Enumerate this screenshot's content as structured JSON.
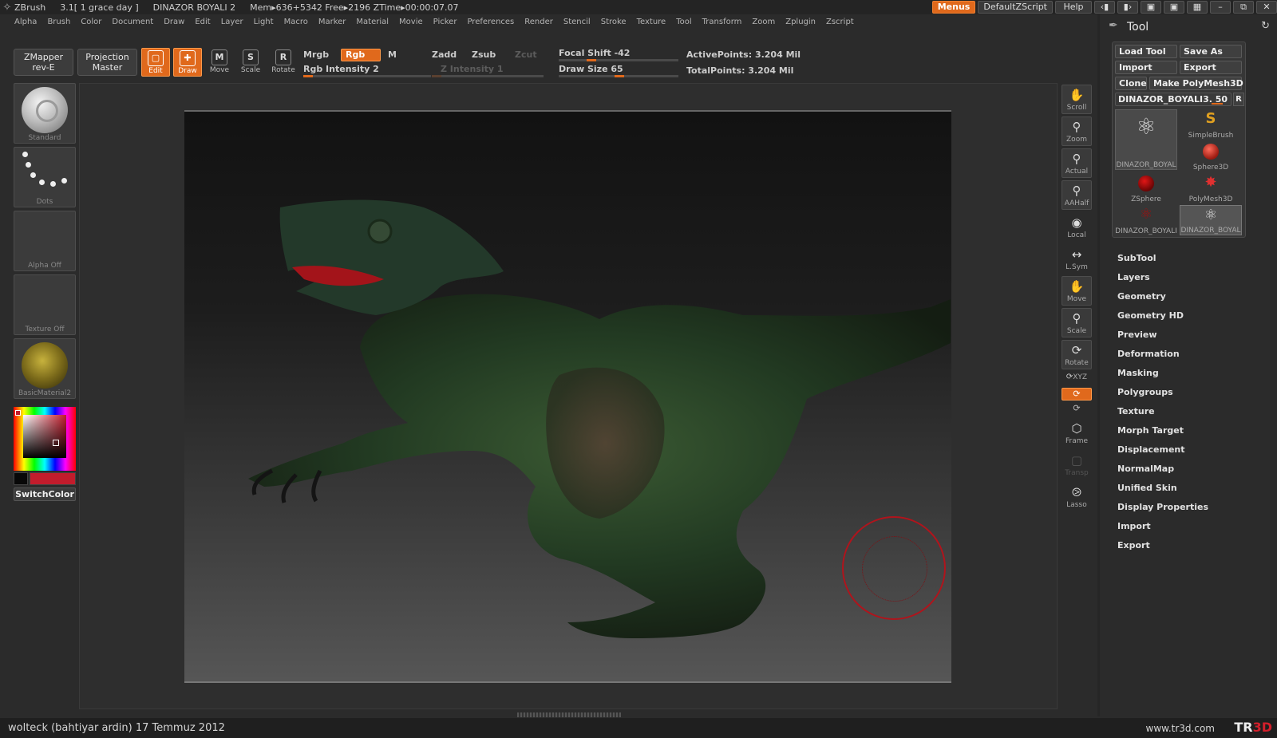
{
  "titlebar": {
    "app": "ZBrush",
    "version": "3.1[ 1 grace day ]",
    "doc": "DINAZOR BOYALI 2",
    "mem": "Mem▸636+5342 Free▸2196 ZTime▸00:00:07.07",
    "menus_btn": "Menus",
    "script_btn": "DefaultZScript",
    "help_btn": "Help",
    "icons": [
      "split-left-icon",
      "split-right-icon",
      "layout-icon",
      "layout2-icon",
      "lock-icon",
      "minimize-icon",
      "restore-icon",
      "close-icon"
    ]
  },
  "menubar": [
    "Alpha",
    "Brush",
    "Color",
    "Document",
    "Draw",
    "Edit",
    "Layer",
    "Light",
    "Macro",
    "Marker",
    "Material",
    "Movie",
    "Picker",
    "Preferences",
    "Render",
    "Stencil",
    "Stroke",
    "Texture",
    "Tool",
    "Transform",
    "Zoom",
    "Zplugin",
    "Zscript"
  ],
  "toolbar": {
    "zmapper": "ZMapper",
    "zmapper_sub": "rev-E",
    "projection": "Projection",
    "projection_sub": "Master",
    "edit": "Edit",
    "draw": "Draw",
    "move": "Move",
    "scale": "Scale",
    "rotate": "Rotate",
    "mrgb": "Mrgb",
    "rgb": "Rgb",
    "m": "M",
    "rgb_intensity": "Rgb Intensity 2",
    "zadd": "Zadd",
    "zsub": "Zsub",
    "zcut": "Zcut",
    "z_intensity": "Z Intensity 1",
    "focal_shift": "Focal Shift -42",
    "draw_size": "Draw Size 65",
    "active_points": "ActivePoints: 3.204 Mil",
    "total_points": "TotalPoints: 3.204 Mil"
  },
  "left_shelf": {
    "brush": "Standard",
    "stroke": "Dots",
    "alpha": "Alpha Off",
    "texture": "Texture Off",
    "material": "BasicMaterial2",
    "switch_color": "SwitchColor",
    "main_color": "#c21c2c",
    "secondary_color": "#080808"
  },
  "right_shelf": [
    {
      "label": "Scroll",
      "icon": "hand-icon"
    },
    {
      "label": "Zoom",
      "icon": "magnifier-icon"
    },
    {
      "label": "Actual",
      "icon": "actual-icon"
    },
    {
      "label": "AAHalf",
      "icon": "aahalf-icon"
    },
    {
      "label": "Local",
      "icon": "local-icon"
    },
    {
      "label": "L.Sym",
      "icon": "lsym-icon"
    },
    {
      "label": "Move",
      "icon": "move-hand-icon"
    },
    {
      "label": "Scale",
      "icon": "scale-icon"
    },
    {
      "label": "Rotate",
      "icon": "rotate-icon"
    },
    {
      "label": "XYZ",
      "icon": "xyz-icon"
    },
    {
      "label": "Frame",
      "icon": "frame-icon"
    },
    {
      "label": "Transp",
      "icon": "transp-icon"
    },
    {
      "label": "Lasso",
      "icon": "lasso-icon"
    }
  ],
  "tool_panel": {
    "title": "Tool",
    "load_tool": "Load Tool",
    "save_as": "Save As",
    "import": "Import",
    "export": "Export",
    "clone": "Clone",
    "make_polymesh": "Make PolyMesh3D",
    "current_tool": "DINAZOR_BOYALI3. 50",
    "r_btn": "R",
    "thumbs": [
      "DINAZOR_BOYAL",
      "SimpleBrush",
      "Sphere3D",
      "ZSphere",
      "PolyMesh3D",
      "DINAZOR_BOYALI",
      "DINAZOR_BOYAL"
    ],
    "sections": [
      "SubTool",
      "Layers",
      "Geometry",
      "Geometry HD",
      "Preview",
      "Deformation",
      "Masking",
      "Polygroups",
      "Texture",
      "Morph Target",
      "Displacement",
      "NormalMap",
      "Unified Skin",
      "Display Properties",
      "Import",
      "Export"
    ]
  },
  "footer": {
    "credit": "wolteck (bahtiyar ardin)  17 Temmuz 2012",
    "site": "www.tr3d.com",
    "logo_a": "TR",
    "logo_b": "3D"
  },
  "accent": "#e0691c",
  "brush_cursor_color": "#b0141c"
}
